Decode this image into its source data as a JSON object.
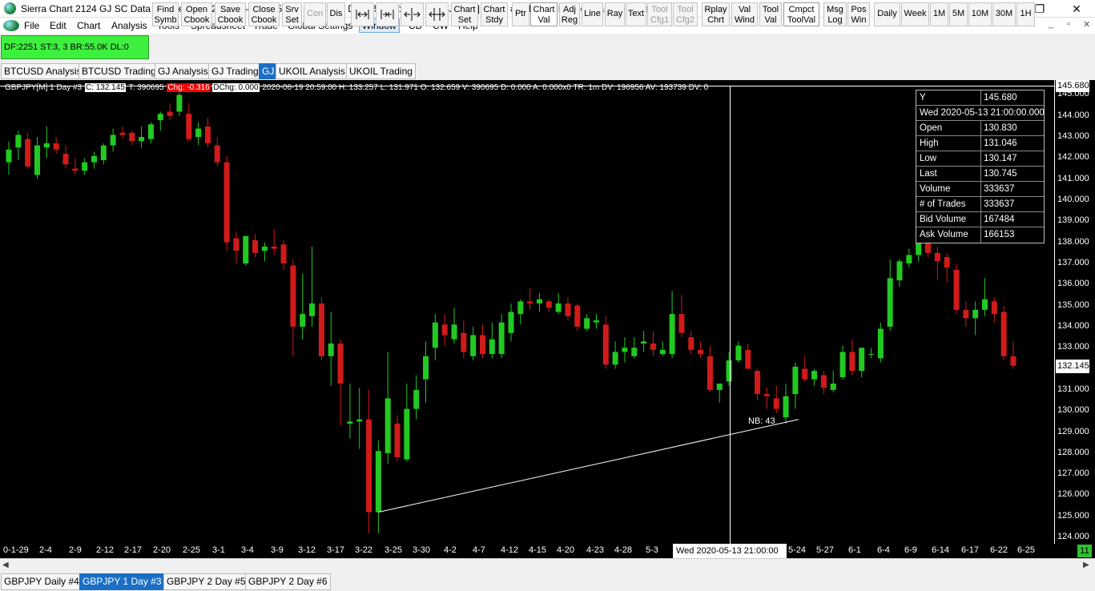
{
  "window": {
    "title": "Sierra Chart 2124 GJ  SC Data - All Services 2020-06-21  05:58:42 Sun [Sim]  DF:2251  ST:3, 3  - [GBPJPY[M]  1 Day   #3 | British Pound / Japanese Yen]",
    "minimize": "─",
    "restore": "❐",
    "close": "✕"
  },
  "menu": {
    "items": [
      "File",
      "Edit",
      "Chart",
      "Analysis",
      "Tools",
      "Spreadsheet",
      "Trade",
      "Global Settings",
      "Window",
      "CB",
      "CW",
      "Help"
    ],
    "mdi_min": "_",
    "mdi_restore": "▫",
    "mdi_close": "✕"
  },
  "toolbar": {
    "status": "DF:2251  ST:3, 3  BR:55.0K  DL:0",
    "find_symb": "Find\nSymb",
    "open_cbook": "Open\nCbook",
    "save_cbook": "Save\nCbook",
    "close_cbook": "Close\nCbook",
    "srv_set": "Srv\nSet",
    "con": "Con",
    "dis": "Dis",
    "chart_set": "Chart\nSet",
    "chart_stdy": "Chart\nStdy",
    "ptr": "Ptr",
    "chart_val": "Chart\nVal",
    "adj_reg": "Adj\nReg",
    "line": "Line",
    "ray": "Ray",
    "text": "Text",
    "tool_cfg1": "Tool\nCfg1",
    "tool_cfg2": "Tool\nCfg2",
    "rplay_chrt": "Rplay\nChrt",
    "val_wind": "Val\nWind",
    "tool_val": "Tool\nVal",
    "cmpct_toolval": "Cmpct\nToolVal",
    "msg_log": "Msg\nLog",
    "pos_win": "Pos\nWin",
    "daily": "Daily",
    "week": "Week",
    "p1m": "1M",
    "p5m": "5M",
    "p10m": "10M",
    "p30m": "30M",
    "p1h": "1H"
  },
  "chartbook_tabs": [
    "BTCUSD Analysis",
    "BTCUSD Trading",
    "GJ Analysis",
    "GJ Trading",
    "GJ",
    "UKOIL Analysis",
    "UKOIL Trading"
  ],
  "chart_header": {
    "symbol": "GBPJPY[M]  1 Day   #3",
    "close": "C: 132.145",
    "trades": "T: 390695",
    "chg": "Chg: -0.316",
    "dchg": "DChg: 0.000",
    "rest": "2020-06-19 20:59:00 H: 133.257  L: 131.971  O: 132.659  V: 390695  D: 0.000  A: 0.000x0  TR: 1m  DV: 196956  AV: 193739  DV: 0"
  },
  "tooltip": {
    "y_label": "Y",
    "y_value": "145.680",
    "datetime": "Wed 2020-05-13  21:00:00.000",
    "rows": [
      {
        "k": "Open",
        "v": "130.830"
      },
      {
        "k": "High",
        "v": "131.046"
      },
      {
        "k": "Low",
        "v": "130.147"
      },
      {
        "k": "Last",
        "v": "130.745"
      },
      {
        "k": "Volume",
        "v": "333637"
      },
      {
        "k": "# of Trades",
        "v": "333637"
      },
      {
        "k": "Bid Volume",
        "v": "167484"
      },
      {
        "k": "Ask Volume",
        "v": "166153"
      }
    ]
  },
  "price_axis": {
    "top_value": "145.680",
    "last_value": "132.145",
    "ticks": [
      "145.000",
      "144.000",
      "143.000",
      "142.000",
      "141.000",
      "140.000",
      "139.000",
      "138.000",
      "137.000",
      "136.000",
      "135.000",
      "134.000",
      "133.000",
      "131.000",
      "130.000",
      "129.000",
      "128.000",
      "127.000",
      "126.000",
      "125.000",
      "124.000"
    ]
  },
  "time_axis": {
    "labels": [
      "0-1-29",
      "2-4",
      "2-9",
      "2-12",
      "2-17",
      "2-20",
      "2-25",
      "3-1",
      "3-4",
      "3-9",
      "3-12",
      "3-17",
      "3-22",
      "3-25",
      "3-30",
      "4-2",
      "4-7",
      "4-12",
      "4-15",
      "4-20",
      "4-23",
      "4-28",
      "5-3",
      "5-24",
      "5-27",
      "6-1",
      "6-4",
      "6-9",
      "6-14",
      "6-17",
      "6-22",
      "6-25"
    ],
    "cursor_label": "Wed 2020-05-13  21:00:00",
    "badge": "11"
  },
  "annotation": {
    "label": "NB: 43"
  },
  "colors": {
    "up": "#22c922",
    "down": "#d11a1a",
    "bg": "#000000",
    "accent": "#1a6fc4"
  },
  "chart_data": {
    "type": "candlestick",
    "title": "GBPJPY[M]  1 Day   #3",
    "y_range": [
      123.7,
      145.7
    ],
    "candles": [
      {
        "o": 141.8,
        "h": 142.8,
        "l": 141.2,
        "c": 142.4
      },
      {
        "o": 142.5,
        "h": 143.3,
        "l": 141.9,
        "c": 143.1
      },
      {
        "o": 142.9,
        "h": 143.2,
        "l": 141.5,
        "c": 141.6
      },
      {
        "o": 141.2,
        "h": 143.0,
        "l": 141.0,
        "c": 142.6
      },
      {
        "o": 142.5,
        "h": 143.5,
        "l": 142.0,
        "c": 142.7
      },
      {
        "o": 142.7,
        "h": 143.0,
        "l": 142.2,
        "c": 142.4
      },
      {
        "o": 142.2,
        "h": 142.6,
        "l": 141.5,
        "c": 141.7
      },
      {
        "o": 141.5,
        "h": 142.0,
        "l": 141.2,
        "c": 141.4
      },
      {
        "o": 141.4,
        "h": 142.0,
        "l": 141.2,
        "c": 141.8
      },
      {
        "o": 141.8,
        "h": 142.3,
        "l": 141.5,
        "c": 142.1
      },
      {
        "o": 141.9,
        "h": 142.7,
        "l": 141.7,
        "c": 142.6
      },
      {
        "o": 142.6,
        "h": 143.4,
        "l": 142.3,
        "c": 143.1
      },
      {
        "o": 143.2,
        "h": 143.5,
        "l": 142.9,
        "c": 143.1
      },
      {
        "o": 143.2,
        "h": 143.3,
        "l": 142.6,
        "c": 142.8
      },
      {
        "o": 142.8,
        "h": 143.5,
        "l": 142.5,
        "c": 143.0
      },
      {
        "o": 142.9,
        "h": 143.7,
        "l": 142.7,
        "c": 143.6
      },
      {
        "o": 143.8,
        "h": 144.2,
        "l": 143.3,
        "c": 144.1
      },
      {
        "o": 144.2,
        "h": 144.6,
        "l": 143.8,
        "c": 144.0
      },
      {
        "o": 144.2,
        "h": 145.1,
        "l": 144.0,
        "c": 145.0
      },
      {
        "o": 144.1,
        "h": 144.6,
        "l": 142.8,
        "c": 142.9
      },
      {
        "o": 143.0,
        "h": 143.7,
        "l": 142.6,
        "c": 143.4
      },
      {
        "o": 143.5,
        "h": 143.9,
        "l": 142.5,
        "c": 142.7
      },
      {
        "o": 142.6,
        "h": 143.0,
        "l": 141.6,
        "c": 141.8
      },
      {
        "o": 141.8,
        "h": 142.1,
        "l": 137.6,
        "c": 138.0
      },
      {
        "o": 138.2,
        "h": 138.5,
        "l": 137.0,
        "c": 137.6
      },
      {
        "o": 137.0,
        "h": 138.3,
        "l": 136.9,
        "c": 138.3
      },
      {
        "o": 138.1,
        "h": 138.4,
        "l": 137.3,
        "c": 137.5
      },
      {
        "o": 137.6,
        "h": 138.0,
        "l": 137.1,
        "c": 137.8
      },
      {
        "o": 137.8,
        "h": 138.6,
        "l": 137.4,
        "c": 137.7
      },
      {
        "o": 137.9,
        "h": 138.1,
        "l": 136.7,
        "c": 137.0
      },
      {
        "o": 136.9,
        "h": 137.2,
        "l": 132.6,
        "c": 134.0
      },
      {
        "o": 134.0,
        "h": 136.5,
        "l": 133.4,
        "c": 134.6
      },
      {
        "o": 134.5,
        "h": 137.8,
        "l": 134.0,
        "c": 135.1
      },
      {
        "o": 135.1,
        "h": 135.4,
        "l": 132.4,
        "c": 132.6
      },
      {
        "o": 132.6,
        "h": 134.7,
        "l": 131.2,
        "c": 133.2
      },
      {
        "o": 133.2,
        "h": 133.4,
        "l": 129.3,
        "c": 131.3
      },
      {
        "o": 129.4,
        "h": 131.3,
        "l": 128.7,
        "c": 129.5
      },
      {
        "o": 129.5,
        "h": 131.1,
        "l": 128.2,
        "c": 129.6
      },
      {
        "o": 129.6,
        "h": 131.0,
        "l": 124.2,
        "c": 125.2
      },
      {
        "o": 125.2,
        "h": 128.6,
        "l": 124.2,
        "c": 128.1
      },
      {
        "o": 128.0,
        "h": 132.8,
        "l": 127.5,
        "c": 130.6
      },
      {
        "o": 129.4,
        "h": 129.8,
        "l": 127.6,
        "c": 127.8
      },
      {
        "o": 127.7,
        "h": 131.3,
        "l": 127.6,
        "c": 130.1
      },
      {
        "o": 130.1,
        "h": 131.7,
        "l": 129.6,
        "c": 131.0
      },
      {
        "o": 131.5,
        "h": 133.3,
        "l": 130.4,
        "c": 132.6
      },
      {
        "o": 133.0,
        "h": 134.6,
        "l": 132.4,
        "c": 134.2
      },
      {
        "o": 134.1,
        "h": 134.6,
        "l": 133.1,
        "c": 133.6
      },
      {
        "o": 133.4,
        "h": 134.9,
        "l": 133.2,
        "c": 134.1
      },
      {
        "o": 133.7,
        "h": 134.3,
        "l": 132.5,
        "c": 132.8
      },
      {
        "o": 132.6,
        "h": 134.0,
        "l": 132.4,
        "c": 133.6
      },
      {
        "o": 133.6,
        "h": 134.1,
        "l": 132.5,
        "c": 132.7
      },
      {
        "o": 132.7,
        "h": 134.2,
        "l": 132.5,
        "c": 133.4
      },
      {
        "o": 132.7,
        "h": 134.6,
        "l": 132.5,
        "c": 134.2
      },
      {
        "o": 133.7,
        "h": 135.1,
        "l": 133.3,
        "c": 134.7
      },
      {
        "o": 134.6,
        "h": 135.3,
        "l": 134.1,
        "c": 135.2
      },
      {
        "o": 135.2,
        "h": 135.8,
        "l": 134.8,
        "c": 135.1
      },
      {
        "o": 135.1,
        "h": 135.6,
        "l": 134.7,
        "c": 135.3
      },
      {
        "o": 135.2,
        "h": 135.3,
        "l": 134.7,
        "c": 134.9
      },
      {
        "o": 134.7,
        "h": 135.6,
        "l": 134.6,
        "c": 135.1
      },
      {
        "o": 135.1,
        "h": 135.4,
        "l": 134.3,
        "c": 134.5
      },
      {
        "o": 135.0,
        "h": 135.1,
        "l": 133.8,
        "c": 134.0
      },
      {
        "o": 133.9,
        "h": 134.6,
        "l": 133.8,
        "c": 134.4
      },
      {
        "o": 134.2,
        "h": 134.6,
        "l": 133.9,
        "c": 134.3
      },
      {
        "o": 134.1,
        "h": 134.5,
        "l": 132.0,
        "c": 132.2
      },
      {
        "o": 132.2,
        "h": 133.3,
        "l": 132.0,
        "c": 132.8
      },
      {
        "o": 132.8,
        "h": 133.5,
        "l": 132.3,
        "c": 133.0
      },
      {
        "o": 132.6,
        "h": 133.5,
        "l": 132.5,
        "c": 133.0
      },
      {
        "o": 133.2,
        "h": 133.8,
        "l": 132.8,
        "c": 133.3
      },
      {
        "o": 133.2,
        "h": 133.8,
        "l": 132.6,
        "c": 132.9
      },
      {
        "o": 132.7,
        "h": 133.3,
        "l": 132.6,
        "c": 132.9
      },
      {
        "o": 132.7,
        "h": 135.7,
        "l": 132.5,
        "c": 134.6
      },
      {
        "o": 134.6,
        "h": 135.5,
        "l": 133.5,
        "c": 133.7
      },
      {
        "o": 133.5,
        "h": 133.8,
        "l": 132.7,
        "c": 132.9
      },
      {
        "o": 132.9,
        "h": 133.3,
        "l": 132.5,
        "c": 132.7
      },
      {
        "o": 132.6,
        "h": 133.1,
        "l": 130.9,
        "c": 131.0
      },
      {
        "o": 131.0,
        "h": 131.3,
        "l": 130.4,
        "c": 131.3
      },
      {
        "o": 131.4,
        "h": 132.8,
        "l": 131.2,
        "c": 132.4
      },
      {
        "o": 132.4,
        "h": 133.3,
        "l": 132.3,
        "c": 133.1
      },
      {
        "o": 132.9,
        "h": 133.2,
        "l": 132.0,
        "c": 132.0
      },
      {
        "o": 131.9,
        "h": 132.0,
        "l": 130.5,
        "c": 130.8
      },
      {
        "o": 130.8,
        "h": 131.1,
        "l": 130.1,
        "c": 130.7
      },
      {
        "o": 130.6,
        "h": 131.2,
        "l": 129.9,
        "c": 130.1
      },
      {
        "o": 129.7,
        "h": 131.3,
        "l": 129.4,
        "c": 130.7
      },
      {
        "o": 130.8,
        "h": 132.3,
        "l": 130.1,
        "c": 132.1
      },
      {
        "o": 132.0,
        "h": 132.6,
        "l": 131.4,
        "c": 131.5
      },
      {
        "o": 131.5,
        "h": 132.0,
        "l": 131.2,
        "c": 131.9
      },
      {
        "o": 131.7,
        "h": 131.9,
        "l": 130.8,
        "c": 131.1
      },
      {
        "o": 131.0,
        "h": 131.9,
        "l": 130.9,
        "c": 131.3
      },
      {
        "o": 131.6,
        "h": 133.1,
        "l": 131.5,
        "c": 132.8
      },
      {
        "o": 132.8,
        "h": 133.4,
        "l": 131.7,
        "c": 131.9
      },
      {
        "o": 131.9,
        "h": 133.0,
        "l": 131.6,
        "c": 133.0
      },
      {
        "o": 132.7,
        "h": 133.0,
        "l": 132.5,
        "c": 132.7
      },
      {
        "o": 132.5,
        "h": 134.2,
        "l": 132.3,
        "c": 133.9
      },
      {
        "o": 134.0,
        "h": 137.2,
        "l": 133.8,
        "c": 136.3
      },
      {
        "o": 136.2,
        "h": 137.2,
        "l": 135.9,
        "c": 137.1
      },
      {
        "o": 137.0,
        "h": 137.7,
        "l": 136.8,
        "c": 137.4
      },
      {
        "o": 137.4,
        "h": 139.7,
        "l": 137.1,
        "c": 139.3
      },
      {
        "o": 139.3,
        "h": 139.6,
        "l": 137.3,
        "c": 137.5
      },
      {
        "o": 137.5,
        "h": 137.8,
        "l": 136.2,
        "c": 137.1
      },
      {
        "o": 137.3,
        "h": 137.5,
        "l": 136.1,
        "c": 136.8
      },
      {
        "o": 136.7,
        "h": 137.0,
        "l": 134.6,
        "c": 134.8
      },
      {
        "o": 134.8,
        "h": 135.2,
        "l": 134.0,
        "c": 134.4
      },
      {
        "o": 134.4,
        "h": 135.2,
        "l": 133.6,
        "c": 134.8
      },
      {
        "o": 134.8,
        "h": 136.3,
        "l": 134.5,
        "c": 135.3
      },
      {
        "o": 135.2,
        "h": 135.4,
        "l": 134.2,
        "c": 134.6
      },
      {
        "o": 134.7,
        "h": 135.0,
        "l": 132.4,
        "c": 132.6
      },
      {
        "o": 132.6,
        "h": 133.3,
        "l": 132.0,
        "c": 132.145
      }
    ],
    "trendline": {
      "from": {
        "bar": 39,
        "price": 125.2
      },
      "to": {
        "bar": 83,
        "price": 129.6
      }
    },
    "crosshair_bar": 81
  }
}
